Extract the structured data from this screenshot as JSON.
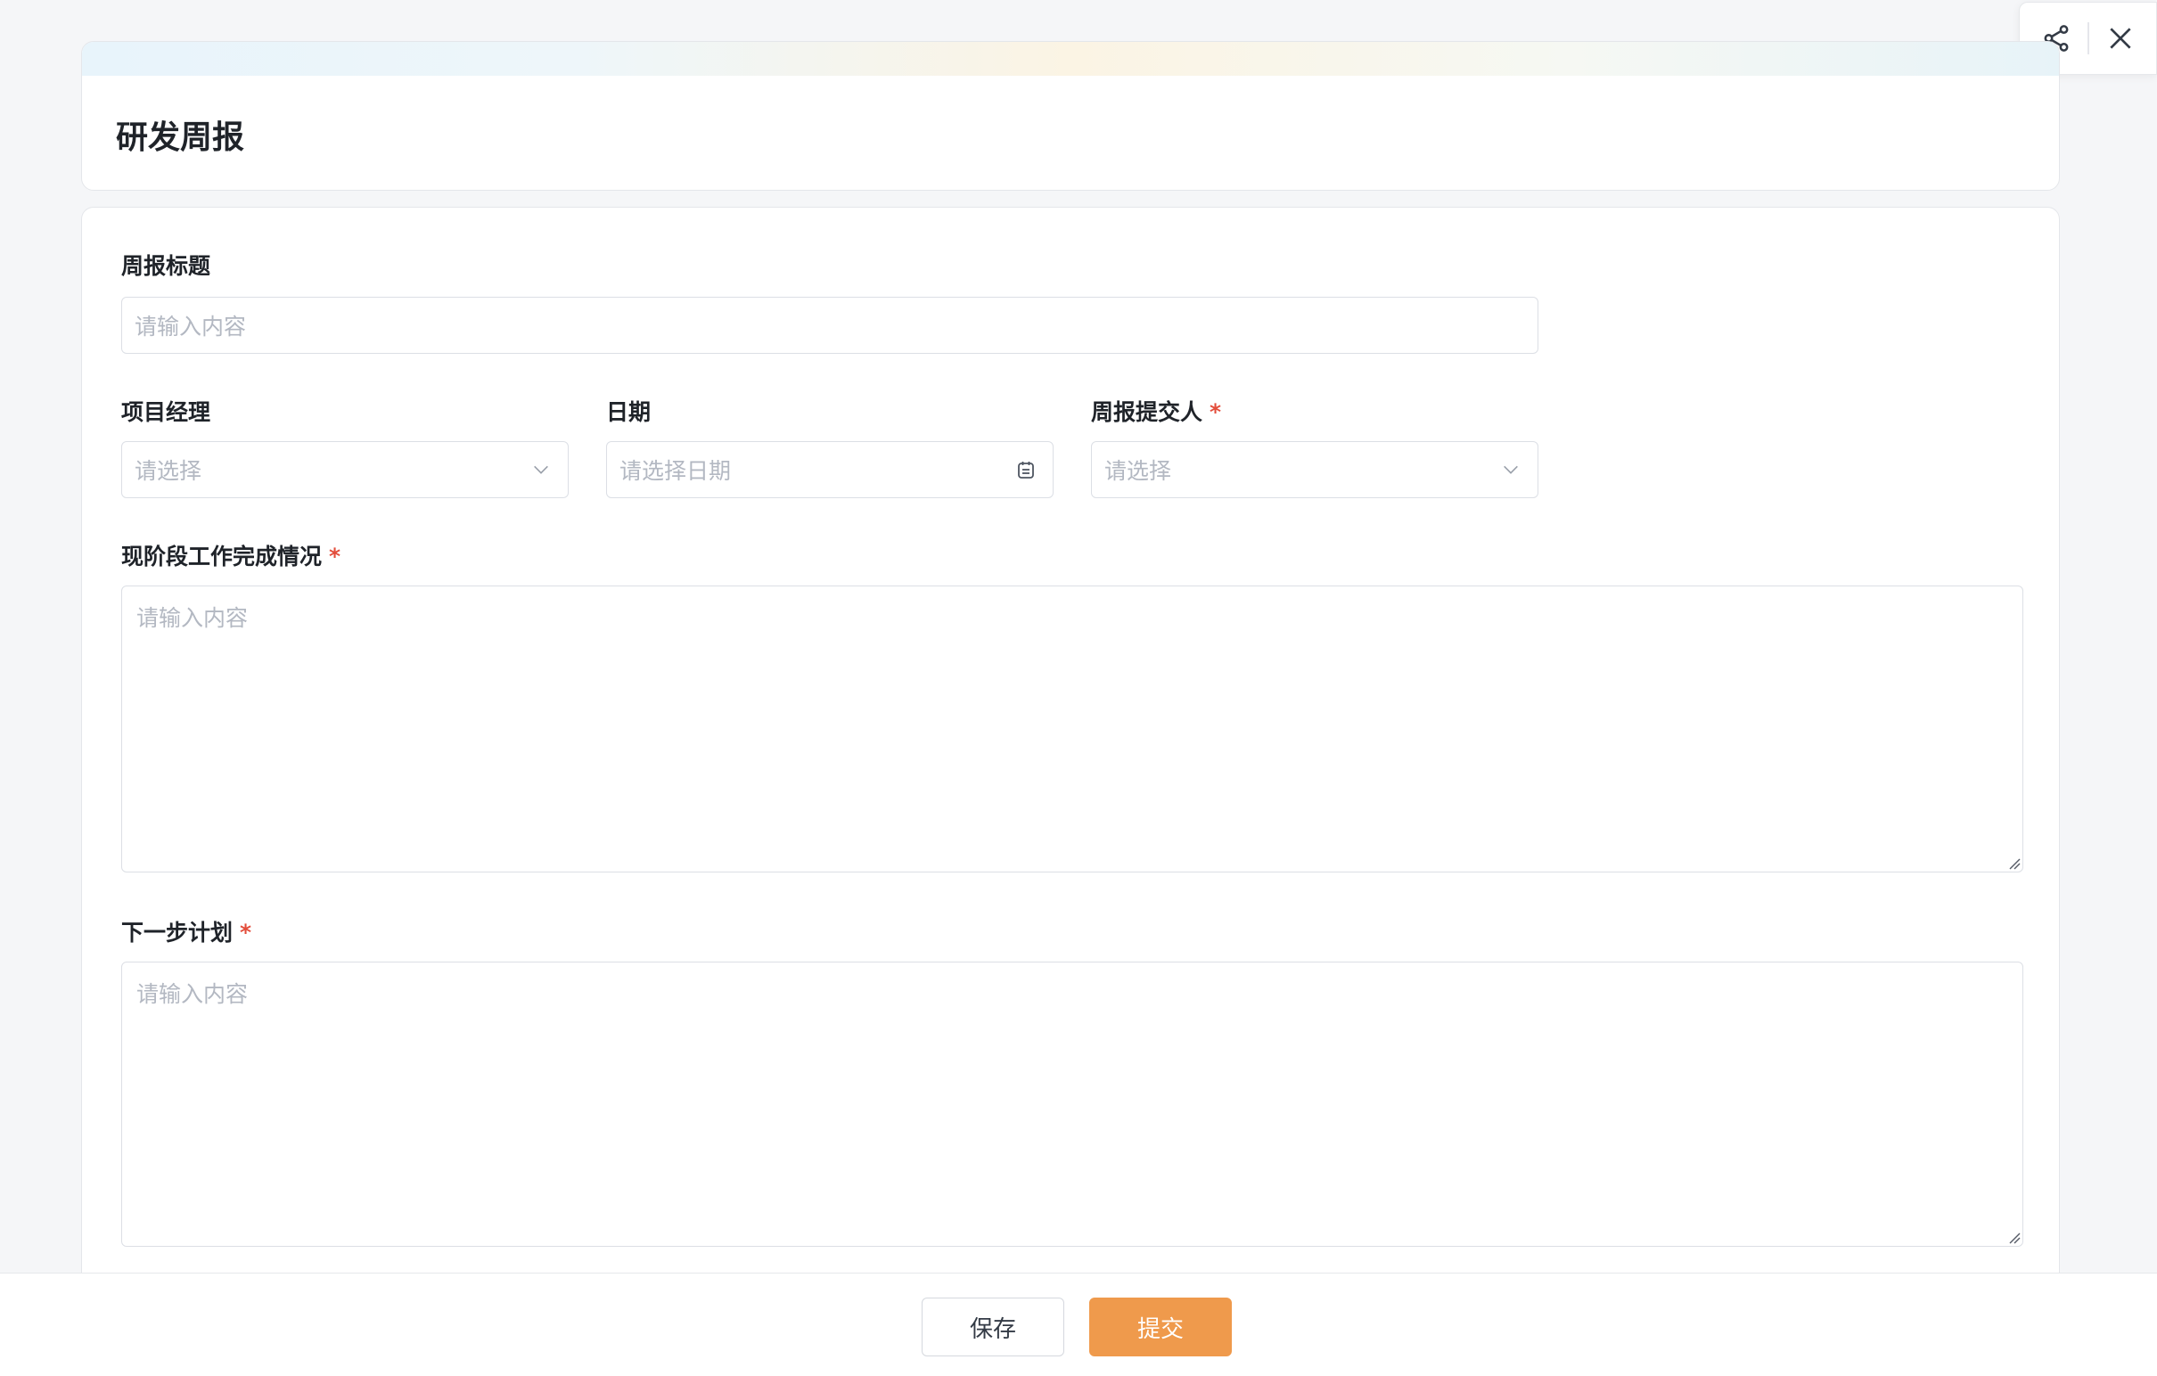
{
  "header": {
    "title": "研发周报"
  },
  "toolbar": {
    "share_icon": "share-icon",
    "close_icon": "close-icon"
  },
  "form": {
    "report_title": {
      "label": "周报标题",
      "placeholder": "请输入内容"
    },
    "project_manager": {
      "label": "项目经理",
      "placeholder": "请选择"
    },
    "date": {
      "label": "日期",
      "placeholder": "请选择日期"
    },
    "submitter": {
      "label": "周报提交人",
      "required_mark": "*",
      "placeholder": "请选择"
    },
    "current_progress": {
      "label": "现阶段工作完成情况",
      "required_mark": "*",
      "placeholder": "请输入内容"
    },
    "next_plan": {
      "label": "下一步计划",
      "required_mark": "*",
      "placeholder": "请输入内容"
    }
  },
  "footer": {
    "save_label": "保存",
    "submit_label": "提交"
  },
  "colors": {
    "accent": "#ef9a4c",
    "required": "#e34d3b",
    "placeholder": "#b3b8c2"
  }
}
